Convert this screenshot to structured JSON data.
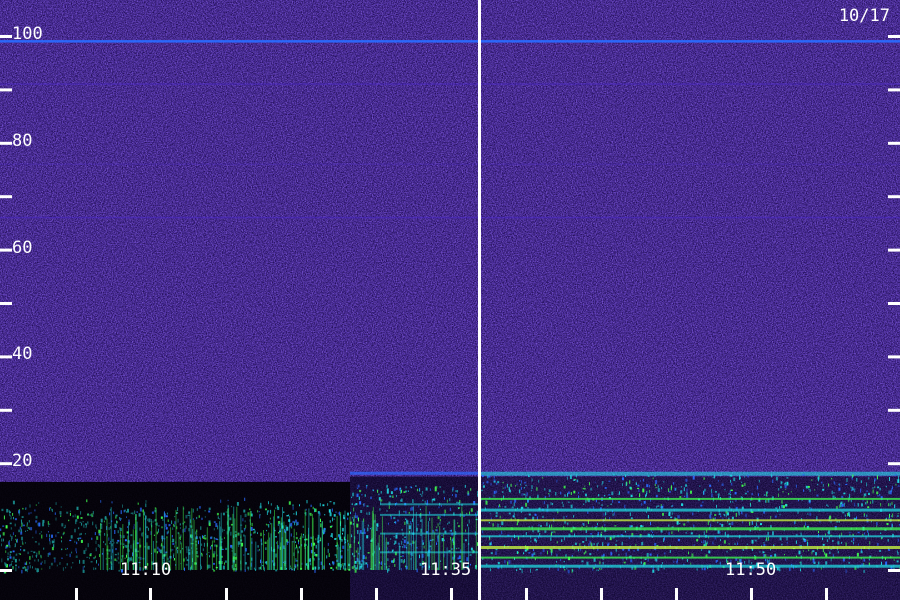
{
  "chart_data": {
    "type": "heatmap",
    "date_label": "10/17",
    "y_axis": {
      "range": [
        0,
        100
      ],
      "major_ticks": [
        20,
        40,
        60,
        80,
        100
      ],
      "minor_ticks": [
        0,
        30,
        50,
        70,
        90
      ],
      "tick_labels": [
        "20",
        "40",
        "60",
        "80",
        "100"
      ]
    },
    "x_axis": {
      "time_labels": [
        "11:10",
        "11:35",
        "11:50"
      ]
    },
    "panels": 2,
    "colors": {
      "background_noise": "#2a1070",
      "noise_low": "#1a0850",
      "noise_high": "#4a28c8",
      "band_bright": "#2a6aff",
      "signal_cyan": "#20d8e0",
      "signal_green": "#40ff50",
      "signal_yellow": "#d0ff40",
      "label": "#ffffff",
      "divider": "#ffffff"
    }
  }
}
